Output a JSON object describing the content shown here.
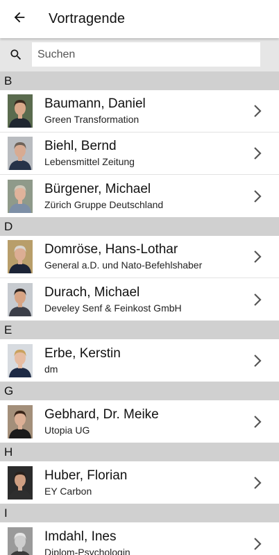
{
  "header": {
    "title": "Vortragende",
    "back_icon": "arrow-left-icon"
  },
  "search": {
    "placeholder": "Suchen",
    "icon": "search-icon"
  },
  "colors": {
    "section_bg": "#d0d0d0",
    "search_bg": "#e6e6e6"
  },
  "sections": [
    {
      "letter": "B",
      "speakers": [
        {
          "name": "Baumann, Daniel",
          "org": "Green Transformation",
          "bg": "#5a6b4e",
          "skin": "#d9a88a",
          "hair": "#3b2a1f",
          "suit": "#1f2630"
        },
        {
          "name": "Biehl, Bernd",
          "org": "Lebensmittel Zeitung",
          "bg": "#b9bcc0",
          "skin": "#d8ab92",
          "hair": "#6e6258",
          "suit": "#263349"
        },
        {
          "name": "Bürgener, Michael",
          "org": "Zürich Gruppe Deutschland",
          "bg": "#8f9a8a",
          "skin": "#e0b39b",
          "hair": "#cfc7b8",
          "suit": "#7d8fa6"
        }
      ]
    },
    {
      "letter": "D",
      "speakers": [
        {
          "name": "Domröse, Hans-Lothar",
          "org": "General a.D. und Nato-Befehlshaber",
          "bg": "#b89e6a",
          "skin": "#dcae94",
          "hair": "#d9d6d0",
          "suit": "#1c2436"
        },
        {
          "name": "Durach, Michael",
          "org": "Develey Senf & Feinkost GmbH",
          "bg": "#c7cbd0",
          "skin": "#d7a484",
          "hair": "#2f2622",
          "suit": "#3b3e48"
        }
      ]
    },
    {
      "letter": "E",
      "speakers": [
        {
          "name": "Erbe, Kerstin",
          "org": "dm",
          "bg": "#d7dbe0",
          "skin": "#e6bca2",
          "hair": "#c9a25f",
          "suit": "#1d2a45"
        }
      ]
    },
    {
      "letter": "G",
      "speakers": [
        {
          "name": "Gebhard, Dr. Meike",
          "org": "Utopia UG",
          "bg": "#a38f7a",
          "skin": "#dcb096",
          "hair": "#3a2519",
          "suit": "#1a1a1a"
        }
      ]
    },
    {
      "letter": "H",
      "speakers": [
        {
          "name": "Huber, Florian",
          "org": "EY Carbon",
          "bg": "#2b2b2b",
          "skin": "#cf9f82",
          "hair": "#2a211c",
          "suit": "#2e2e2e"
        }
      ]
    },
    {
      "letter": "I",
      "speakers": [
        {
          "name": "Imdahl, Ines",
          "org": "Diplom-Psychologin",
          "bg": "#9a9a9a",
          "skin": "#cfcfcf",
          "hair": "#e6e6e6",
          "suit": "#3a3a3a"
        }
      ]
    }
  ]
}
